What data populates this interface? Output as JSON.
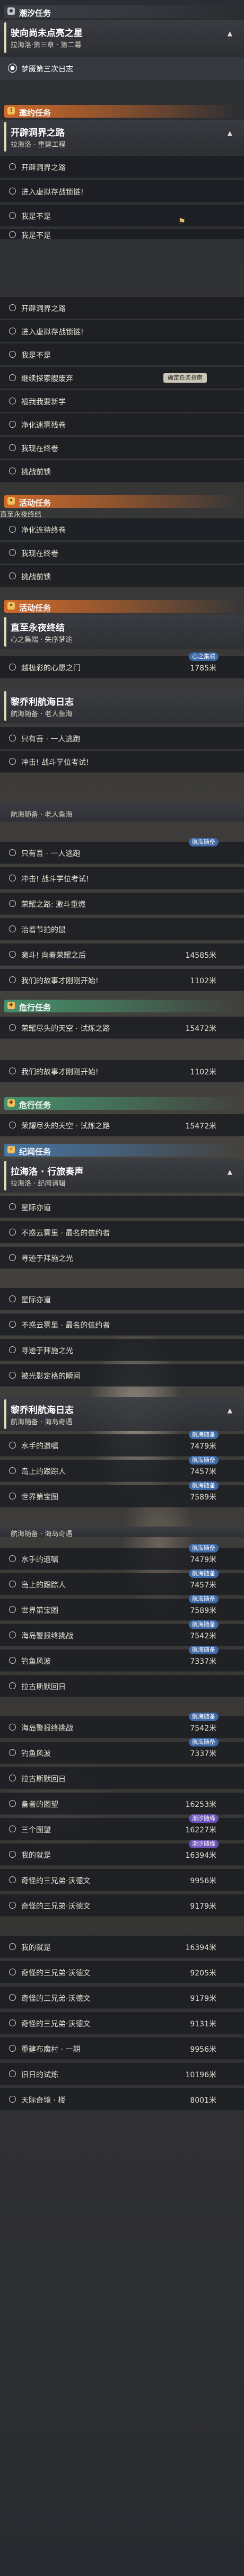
{
  "section_headers": {
    "hunt_top": "潮汐任务",
    "side": "邀约任务",
    "activity": "活动任务",
    "activity_partial": "直至永夜终结",
    "hunt_mid": "危行任务",
    "epic": "纪闻任务"
  },
  "quests": {
    "tidal": {
      "title": "驶向尚未点亮之星",
      "subtitle": "拉海洛·第三章 · 第二幕"
    },
    "pioneer": {
      "title": "开辟洞界之路",
      "subtitle": "拉海洛 · 重建工程"
    },
    "endless": {
      "title": "直至永夜终结",
      "subtitle": "心之集端 · 失序梦途"
    },
    "voyage": {
      "title": "黎乔利航海日志",
      "subtitle": "航海随备 · 老人鱼海"
    },
    "lahailuo": {
      "title": "拉海洛 · 行旅奏声",
      "subtitle": "拉海洛 · 纪闻请辑"
    },
    "voyage2": {
      "title": "黎乔利航海日志",
      "subtitle": "航海随备 · 海岛奇遇"
    }
  },
  "tasks": {
    "t_dream": "梦魇第三次日志",
    "t_enter1": "进入虚拟存战锁链!",
    "t_notyet": "我是不是",
    "t_dream2": "我是不是",
    "t_open1": "开辟洞界之路",
    "t_enter2": "进入虚拟存战锁链!",
    "t_notyet2": "我是不是",
    "t_continue": "继续探索艘废弃",
    "t_mine": "福我我要新学",
    "t_cleanse": "净化迷雾残卷",
    "t_clean_more": "我现在终卷",
    "t_boss": "挑战前锁",
    "t_recon": "净化连待终卷",
    "t_scene": "直至永夜终结",
    "t_gate": "越极彩的心愿之门",
    "t_gate_dist": "1785米",
    "t_voy_a": "只有吾 · 一人逃跑",
    "t_voy_b": "冲击! 战斗学位考试!",
    "t_voy_c": "只有吾 · 一人逃跑",
    "t_voy_d": "冲击! 战斗学位考试!",
    "t_voy_e": "荣耀之路: 激斗重燃",
    "t_voy_f": "治着节拍的鼠",
    "t_voy_g": "激斗! 向着荣耀之后",
    "t_voy_g_dist": "14585米",
    "t_voy_h": "我们的故事才刚刚开始!",
    "t_voy_h_dist": "1102米",
    "t_hunt_a": "荣耀尽头的天空 · 试炼之路",
    "t_hunt_a_dist": "15472米",
    "t_hunt_b": "我们的故事才刚刚开始!",
    "t_hunt_b_dist": "1102米",
    "t_hunt_c": "荣耀尽头的天空 · 试炼之路",
    "t_hunt_c_dist": "15472米",
    "t_epic_a": "星际亦道",
    "t_epic_b": "不惑云雾里 · 最名的信约者",
    "t_epic_c": "寻迹于拜施之光",
    "t_epic_d": "星际亦道",
    "t_epic_e": "不惑云雾里 · 最名的信约者",
    "t_epic_f": "寻迹于拜施之光",
    "t_epic_g": "被光影定格的瞬间",
    "t_v2_a": "水手的遗嘱",
    "t_v2_a_dist": "7479米",
    "t_v2_b": "岛上的跟踪人",
    "t_v2_b_dist": "7457米",
    "t_v2_c": "世界第宝图",
    "t_v2_c_dist": "7589米",
    "t_v2_d": "水手的遗嘱",
    "t_v2_d_dist": "7479米",
    "t_v2_e": "岛上的跟踪人",
    "t_v2_e_dist": "7457米",
    "t_v2_f": "世界第宝图",
    "t_v2_f_dist": "7589米",
    "t_v2_g": "海岛警报终挑战",
    "t_v2_g_dist": "7542米",
    "t_v2_h": "钓鱼风波",
    "t_v2_h_dist": "7337米",
    "t_v2_i": "拉古斯默回日",
    "t_v2_j": "海岛警报终挑战",
    "t_v2_j_dist": "7542米",
    "t_v2_k": "钓鱼风波",
    "t_v2_k_dist": "7337米",
    "t_v2_l": "拉古斯默回日",
    "t_v2_m": "备者的图望",
    "t_v2_m_dist": "16253米",
    "t_v2_n": "三个图望",
    "t_v2_n_dist": "16227米",
    "t_v2_o": "我的就是",
    "t_v2_o_dist": "16394米",
    "t_v2_p": "奇怪的三兄弟·沃德文",
    "t_v2_p_dist": "9956米",
    "t_v2_q": "奇怪的三兄弟·沃德文",
    "t_v2_q_dist": "9179米",
    "t_v2_r": "我的就是",
    "t_v2_r_dist": "16394米",
    "t_v2_s": "奇怪的三兄弟·沃德文",
    "t_v2_s_dist": "9205米",
    "t_v2_t": "奇怪的三兄弟·沃德文",
    "t_v2_t_dist": "9179米",
    "t_v2_u": "奇怪的三兄弟·沃德文",
    "t_v2_u_dist": "9131米",
    "t_v2_v": "重建布魔村 · 一期",
    "t_v2_v_dist": "9956米",
    "t_v2_w": "旧日的试炼",
    "t_v2_w_dist": "10196米",
    "t_v2_x": "天际奇境 · 楼",
    "t_v2_x_dist": "8001米"
  },
  "pills": {
    "heart_blank": "心之集端",
    "voyage": "航海随备",
    "heart": "心之集端",
    "drift": "潮汐随缘"
  },
  "tags": {
    "track": "确定任务指南"
  },
  "colors": {
    "orange": "#dc6e28",
    "teal": "#46966e",
    "blue": "#4678aa"
  }
}
